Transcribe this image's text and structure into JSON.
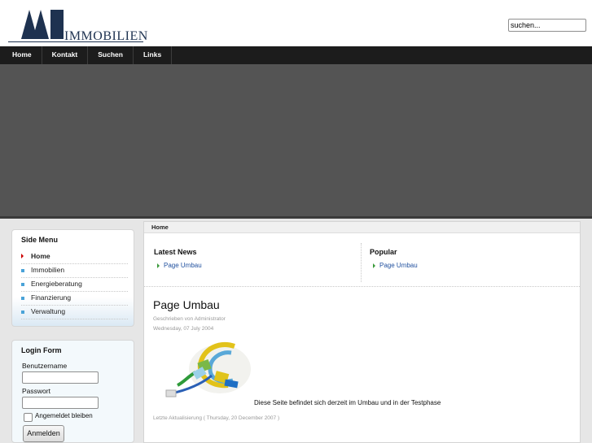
{
  "logo": {
    "mark": "MB",
    "word": "IMMOBILIEN"
  },
  "search": {
    "placeholder": "suchen..."
  },
  "nav": {
    "items": [
      "Home",
      "Kontakt",
      "Suchen",
      "Links"
    ]
  },
  "breadcrumb": "Home",
  "side_menu": {
    "title": "Side Menu",
    "items": [
      "Home",
      "Immobilien",
      "Energieberatung",
      "Finanzierung",
      "Verwaltung"
    ],
    "active": "Home"
  },
  "login": {
    "title": "Login Form",
    "username_label": "Benutzername",
    "password_label": "Passwort",
    "remember_label": "Angemeldet bleiben",
    "button_label": "Anmelden"
  },
  "latest_news": {
    "title": "Latest News",
    "items": [
      "Page Umbau"
    ]
  },
  "popular": {
    "title": "Popular",
    "items": [
      "Page Umbau"
    ]
  },
  "article": {
    "title": "Page Umbau",
    "author": "Geschrieben von Administrator",
    "date": "Wednesday, 07 July 2004",
    "text": "Diese Seite befindet sich derzeit im Umbau und in der Testphase",
    "updated": "Letzte Aktualisierung ( Thursday, 20 December 2007 )"
  },
  "colors": {
    "nav_bg": "#1c1c1c",
    "banner": "#545454",
    "link": "#1f4f9e",
    "accent_bullet": "#4aa3d8"
  }
}
